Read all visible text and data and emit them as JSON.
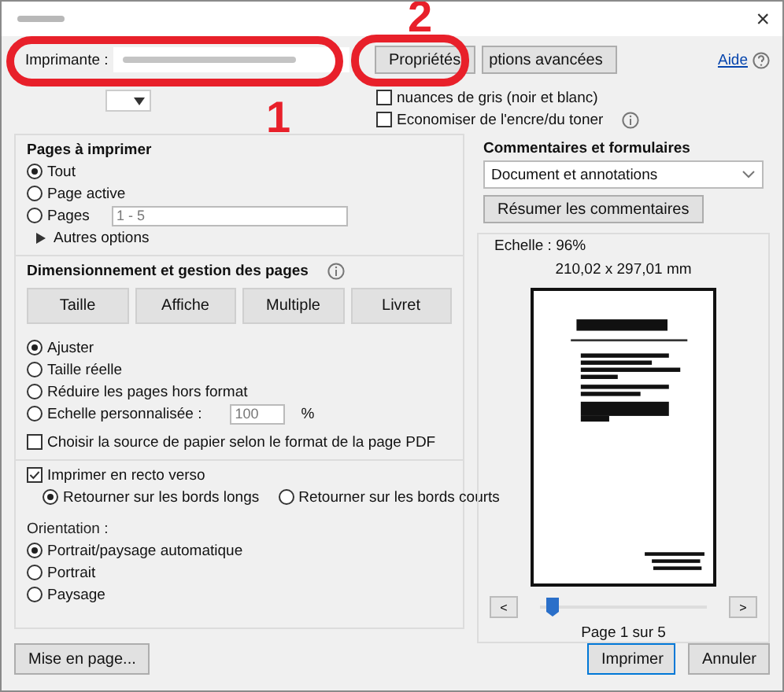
{
  "window": {
    "close": "×"
  },
  "printer": {
    "label": "Imprimante :"
  },
  "properties_button": "Propriétés",
  "advanced_button": "ptions avancées",
  "help_link": "Aide",
  "options": [
    {
      "label": "nuances de gris (noir et blanc)",
      "checked": false
    },
    {
      "label": "Economiser de l'encre/du toner",
      "checked": false,
      "info": true
    }
  ],
  "pages": {
    "title": "Pages à imprimer",
    "choices": [
      {
        "label": "Tout",
        "selected": true
      },
      {
        "label": "Page active",
        "selected": false
      },
      {
        "label": "Pages",
        "selected": false,
        "value": "1 - 5"
      }
    ],
    "more": "Autres options"
  },
  "sizing": {
    "title": "Dimensionnement et gestion des pages",
    "modes": [
      "Taille",
      "Affiche",
      "Multiple",
      "Livret"
    ],
    "choices": [
      {
        "label": "Ajuster",
        "selected": true
      },
      {
        "label": "Taille réelle",
        "selected": false
      },
      {
        "label": "Réduire les pages hors format",
        "selected": false
      },
      {
        "label": "Echelle personnalisée :",
        "selected": false,
        "value": "100",
        "unit": "%"
      }
    ],
    "paper_source": {
      "label": "Choisir la source de papier selon le format de la page PDF",
      "checked": false
    }
  },
  "duplex": {
    "label": "Imprimer en recto verso",
    "checked": true,
    "choices": [
      {
        "label": "Retourner sur les bords longs",
        "selected": true
      },
      {
        "label": "Retourner sur les bords courts",
        "selected": false
      }
    ]
  },
  "orientation": {
    "title": "Orientation :",
    "choices": [
      {
        "label": "Portrait/paysage automatique",
        "selected": true
      },
      {
        "label": "Portrait",
        "selected": false
      },
      {
        "label": "Paysage",
        "selected": false
      }
    ]
  },
  "page_setup_button": "Mise en page...",
  "comments": {
    "title": "Commentaires et formulaires",
    "value": "Document et annotations",
    "summary_button": "Résumer les commentaires"
  },
  "preview": {
    "scale": "Echelle : 96%",
    "size": "210,02 x 297,01 mm",
    "prev": "<",
    "next": ">",
    "level": 0.04,
    "page": "Page 1 sur 5"
  },
  "buttons": [
    {
      "label": "Imprimer",
      "kind": "primary"
    },
    {
      "label": "Annuler",
      "kind": "normal"
    }
  ],
  "annotations": [
    {
      "number": "1"
    },
    {
      "number": "2"
    }
  ]
}
